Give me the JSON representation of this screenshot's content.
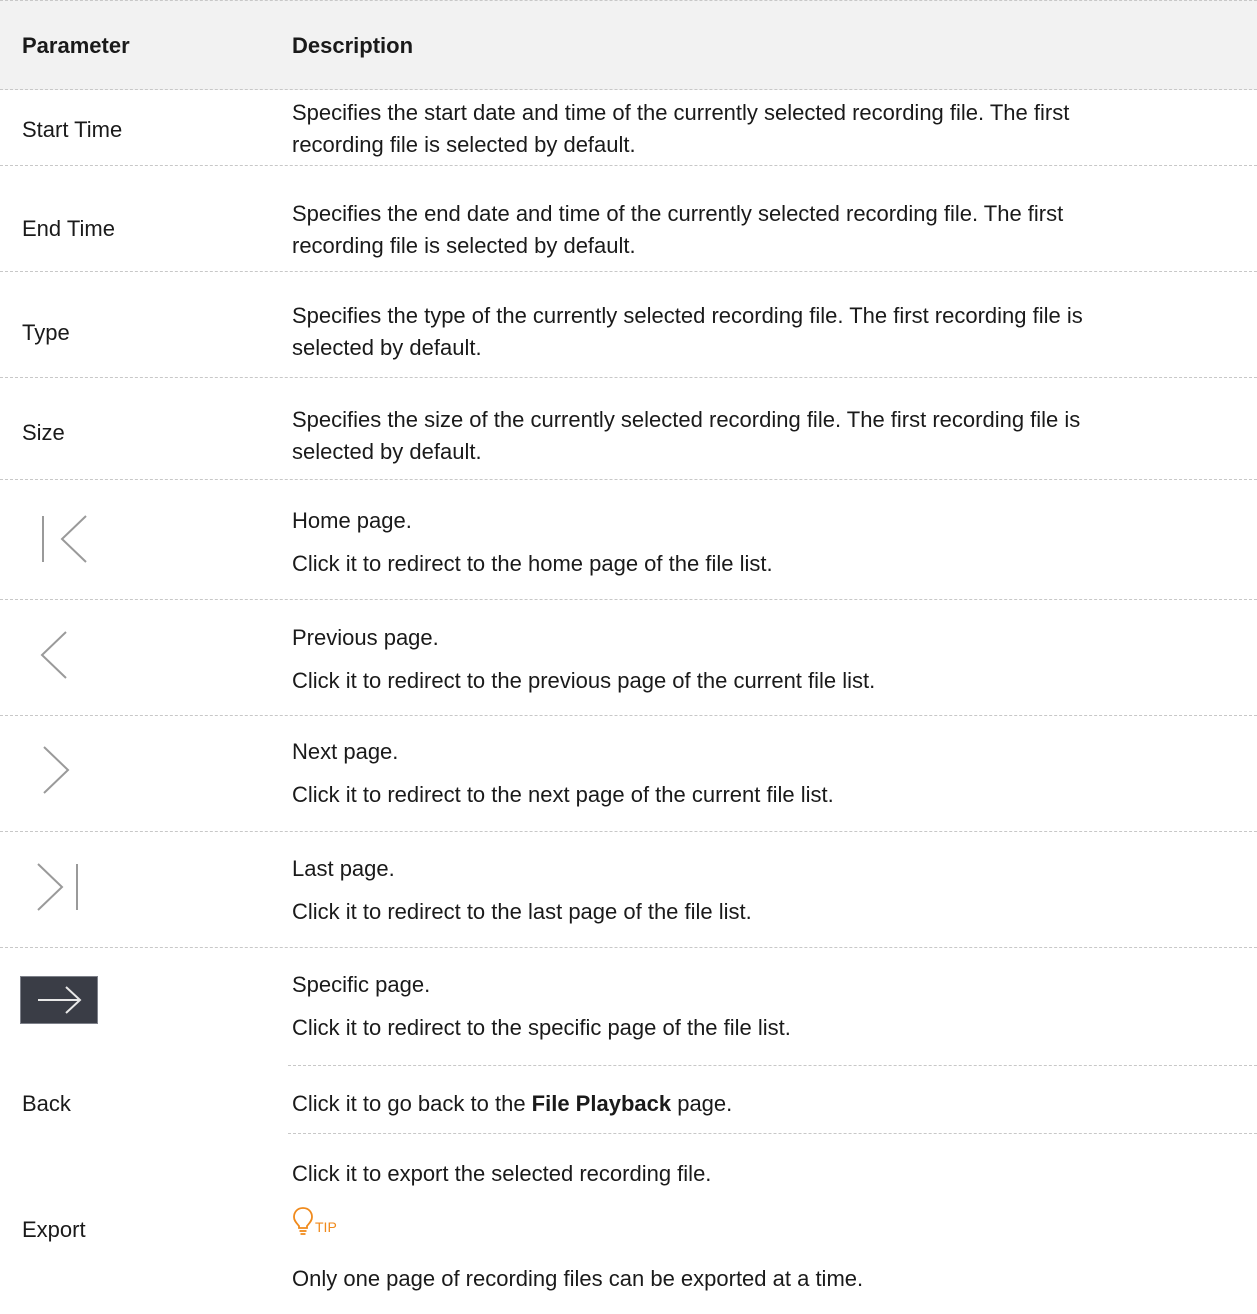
{
  "header": {
    "parameter": "Parameter",
    "description": "Description"
  },
  "rows": [
    {
      "parameter": "Start Time",
      "description": [
        "Specifies the start date and time of the currently selected recording file. The first",
        "recording file is selected by default."
      ]
    },
    {
      "parameter": "End Time",
      "description": [
        "Specifies the end date and time of the currently selected recording file. The first",
        "recording file is selected by default."
      ]
    },
    {
      "parameter": "Type",
      "description": [
        "Specifies the type of the currently selected recording file. The first recording file is",
        "selected by default."
      ]
    },
    {
      "parameter": "Size",
      "description": [
        "Specifies the size of the currently selected recording file. The first recording file is",
        "selected by default."
      ]
    },
    {
      "icon": "first-page-icon",
      "description": [
        "Home page.",
        "Click it to redirect to the home page of the file list."
      ]
    },
    {
      "icon": "previous-page-icon",
      "description": [
        "Previous page.",
        "Click it to redirect to the previous page of the current file list."
      ]
    },
    {
      "icon": "next-page-icon",
      "description": [
        "Next page.",
        "Click it to redirect to the next page of the current file list."
      ]
    },
    {
      "icon": "last-page-icon",
      "description": [
        "Last page.",
        "Click it to redirect to the last page of the file list."
      ]
    },
    {
      "icon": "go-to-page-icon",
      "description": [
        "Specific page.",
        "Click it to redirect to the specific page of the file list."
      ]
    },
    {
      "parameter": "Back",
      "description_parts": [
        "Click it to go back to the ",
        "File Playback",
        " page."
      ]
    },
    {
      "parameter": "Export",
      "description": [
        "Click it to export the selected recording file.",
        "Only one page of recording files can be exported at a time."
      ],
      "tip_label": "TIP"
    }
  ],
  "colors": {
    "header_bg": "#f2f2f2",
    "divider": "#c8c8c8",
    "tip_accent": "#f08a1c",
    "icon_stroke": "#9a9a9a",
    "go_button_bg": "#3a3d46"
  }
}
